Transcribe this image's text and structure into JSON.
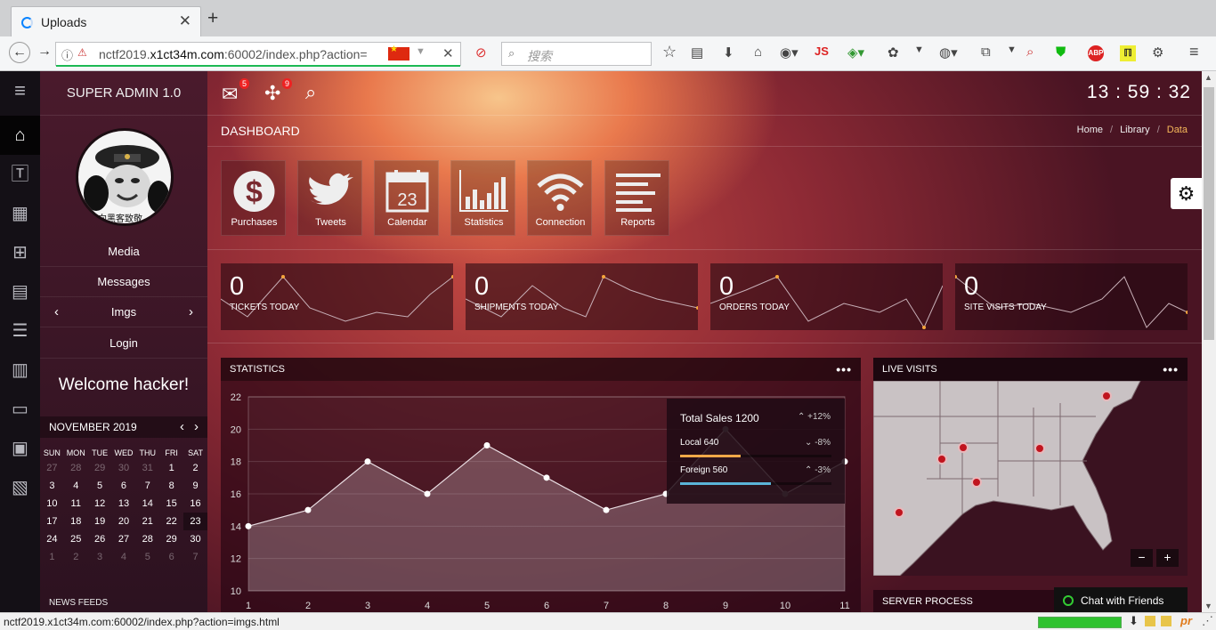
{
  "browser": {
    "tab_title": "Uploads",
    "url_prefix": "nctf2019.",
    "url_domain": "x1ct34m.com",
    "url_suffix": ":60002/index.php?action=",
    "search_placeholder": "搜索",
    "status_url": "nctf2019.x1ct34m.com:60002/index.php?action=imgs.html",
    "toolbar_js_label": "JS"
  },
  "app": {
    "brand": "SUPER ADMIN 1.0",
    "clock": "13 : 59 : 32",
    "page_title": "DASHBOARD",
    "breadcrumb": [
      "Home",
      "Library",
      "Data"
    ],
    "badges": {
      "mail": "5",
      "tasks": "9"
    },
    "menu": {
      "media": "Media",
      "messages": "Messages",
      "imgs": "Imgs",
      "login": "Login",
      "welcome": "Welcome hacker!",
      "avatar_text": "向黑客致敬"
    },
    "calendar": {
      "month": "NOVEMBER 2019",
      "days": [
        "SUN",
        "MON",
        "TUE",
        "WED",
        "THU",
        "FRI",
        "SAT"
      ],
      "weeks": [
        [
          "27",
          "28",
          "29",
          "30",
          "31",
          "1",
          "2"
        ],
        [
          "3",
          "4",
          "5",
          "6",
          "7",
          "8",
          "9"
        ],
        [
          "10",
          "11",
          "12",
          "13",
          "14",
          "15",
          "16"
        ],
        [
          "17",
          "18",
          "19",
          "20",
          "21",
          "22",
          "23"
        ],
        [
          "24",
          "25",
          "26",
          "27",
          "28",
          "29",
          "30"
        ],
        [
          "1",
          "2",
          "3",
          "4",
          "5",
          "6",
          "7"
        ]
      ]
    },
    "news_title": "NEWS FEEDS",
    "tiles": [
      {
        "label": "Purchases",
        "icon": "dollar-icon"
      },
      {
        "label": "Tweets",
        "icon": "twitter-icon"
      },
      {
        "label": "Calendar",
        "icon": "calendar-icon"
      },
      {
        "label": "Statistics",
        "icon": "bar-chart-icon"
      },
      {
        "label": "Connection",
        "icon": "wifi-icon"
      },
      {
        "label": "Reports",
        "icon": "list-icon"
      }
    ],
    "stats": [
      {
        "value": "0",
        "label": "TICKETS TODAY"
      },
      {
        "value": "0",
        "label": "SHIPMENTS TODAY"
      },
      {
        "value": "0",
        "label": "ORDERS TODAY"
      },
      {
        "value": "0",
        "label": "SITE VISITS TODAY"
      }
    ],
    "statistics_title": "STATISTICS",
    "tooltip": {
      "total": "Total Sales 1200",
      "total_change": "+12%",
      "local": "Local 640",
      "local_change": "-8%",
      "foreign": "Foreign 560",
      "foreign_change": "-3%",
      "local_color": "#f0a848",
      "foreign_color": "#5ab4d8"
    },
    "live_title": "LIVE VISITS",
    "server_title": "SERVER PROCESS",
    "chat": "Chat with Friends"
  },
  "chart_data": {
    "type": "area",
    "x": [
      1,
      2,
      3,
      4,
      5,
      6,
      7,
      8,
      9,
      10,
      11
    ],
    "values": [
      14,
      15,
      18,
      16,
      19,
      17,
      15,
      16,
      20,
      16,
      18
    ],
    "ylim": [
      10,
      22
    ],
    "yticks": [
      10,
      12,
      14,
      16,
      18,
      20,
      22
    ],
    "grid": true
  }
}
